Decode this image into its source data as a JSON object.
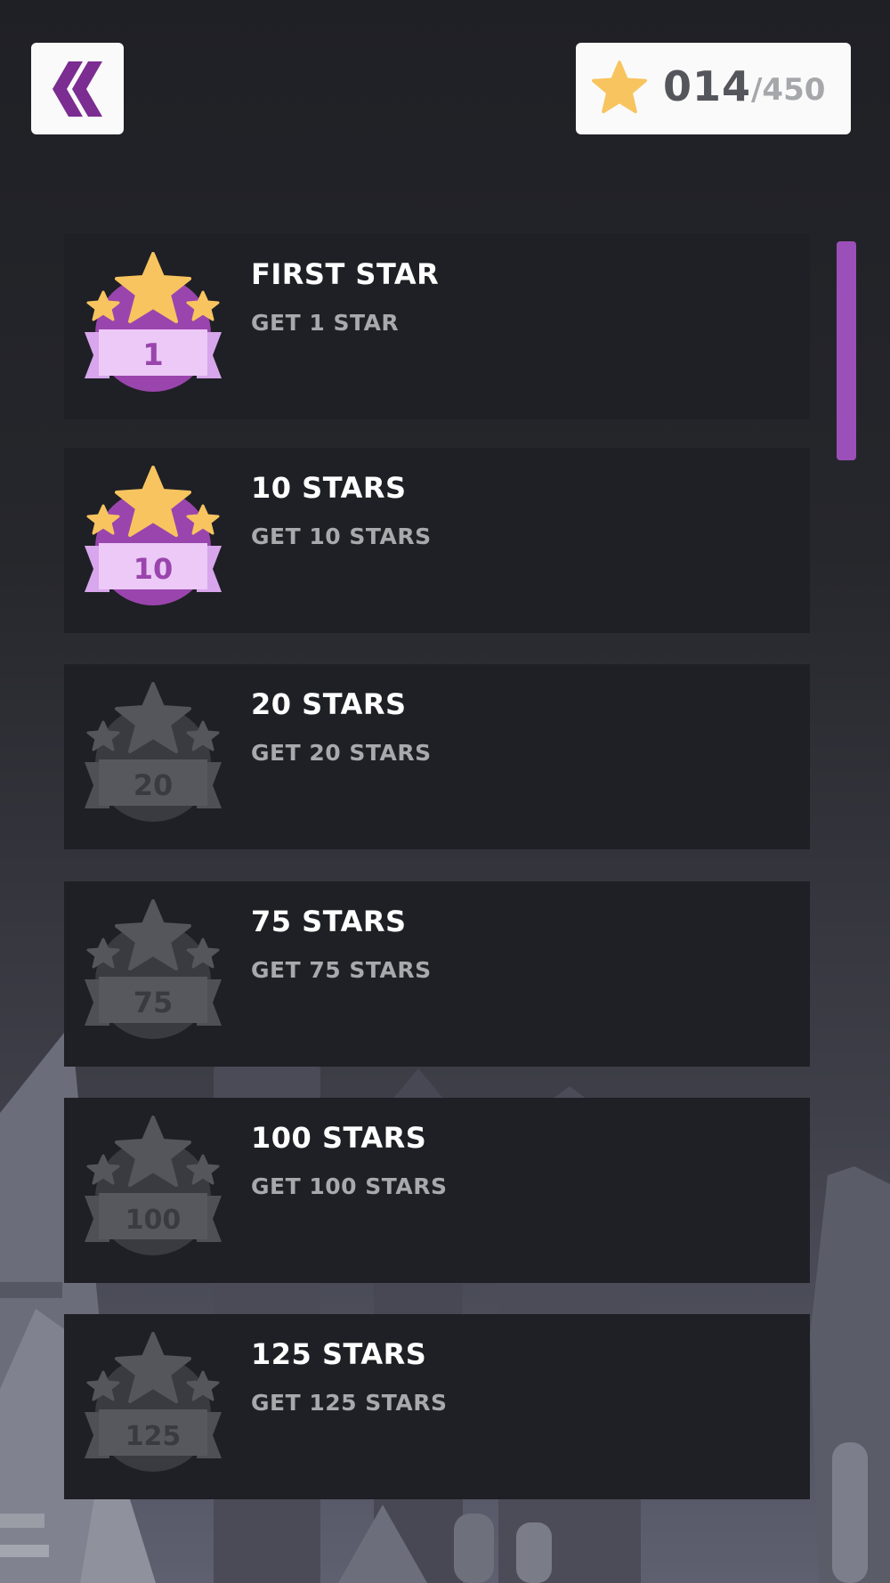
{
  "header": {
    "back_icon": "double-chevron-left-icon",
    "star_icon": "star-icon",
    "stars_collected": "014",
    "stars_total": "/450"
  },
  "achievements": [
    {
      "title": "FIRST STAR",
      "subtitle": "GET 1 STAR",
      "badge_number": "1",
      "unlocked": true
    },
    {
      "title": "10 STARS",
      "subtitle": "GET 10 STARS",
      "badge_number": "10",
      "unlocked": true
    },
    {
      "title": "20 STARS",
      "subtitle": "GET 20 STARS",
      "badge_number": "20",
      "unlocked": false
    },
    {
      "title": "75 STARS",
      "subtitle": "GET 75 STARS",
      "badge_number": "75",
      "unlocked": false
    },
    {
      "title": "100 STARS",
      "subtitle": "GET 100 STARS",
      "badge_number": "100",
      "unlocked": false
    },
    {
      "title": "125 STARS",
      "subtitle": "GET 125 STARS",
      "badge_number": "125",
      "unlocked": false
    }
  ],
  "colors": {
    "accent_purple": "#7b2d91",
    "badge_purple": "#9a45ad",
    "ribbon_purple": "#d8a6ec",
    "ribbon_light": "#ecc9f7",
    "star_gold": "#f7c45f",
    "locked_gray": "#55565b",
    "locked_dark": "#47484d",
    "card_bg": "#1f2025"
  }
}
